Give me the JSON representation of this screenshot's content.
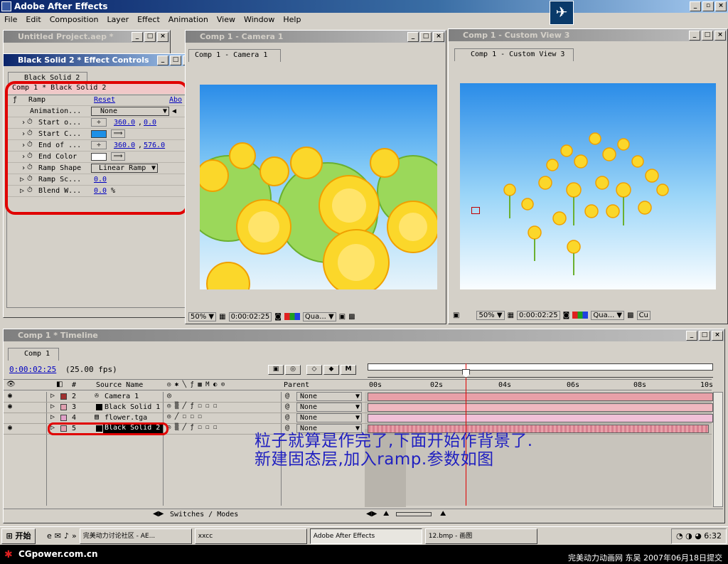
{
  "app": {
    "title": "Adobe After Effects"
  },
  "menu": [
    "File",
    "Edit",
    "Composition",
    "Layer",
    "Effect",
    "Animation",
    "View",
    "Window",
    "Help"
  ],
  "project": {
    "title": "Untitled Project.aep *"
  },
  "effect_controls": {
    "title": "Black Solid 2 * Effect Controls",
    "tab": "Black Solid 2",
    "breadcrumb": "Comp 1 * Black Solid 2",
    "effect_name": "Ramp",
    "reset": "Reset",
    "about": "Abo",
    "props": [
      {
        "label": "Animation...",
        "value": "None"
      },
      {
        "label": "Start o...",
        "v1": "360.0",
        "v2": "0.0"
      },
      {
        "label": "Start C...",
        "color": "#1e90e6"
      },
      {
        "label": "End of ...",
        "v1": "360.0",
        "v2": "576.0"
      },
      {
        "label": "End Color",
        "color": "#ffffff"
      },
      {
        "label": "Ramp Shape",
        "value": "Linear Ramp"
      },
      {
        "label": "Ramp Sc...",
        "value": "0.0"
      },
      {
        "label": "Blend W...",
        "value": "0.0",
        "unit": "%"
      }
    ]
  },
  "comp_camera": {
    "title": "Comp 1 - Camera 1",
    "tab": "Comp 1 - Camera 1",
    "zoom": "50%",
    "time": "0:00:02:25",
    "quality": "Qua..."
  },
  "comp_custom": {
    "title": "Comp 1 - Custom View 3",
    "tab": "Comp 1 - Custom View 3",
    "zoom": "50%",
    "time": "0:00:02:25",
    "quality": "Qua...",
    "view": "Cu"
  },
  "timeline": {
    "title": "Comp 1 * Timeline",
    "tab": "Comp 1",
    "time": "0:00:02:25",
    "fps": "(25.00 fps)",
    "col_num": "#",
    "col_source": "Source Name",
    "col_parent": "Parent",
    "switches_modes": "Switches / Modes",
    "ruler": [
      "00s",
      "02s",
      "04s",
      "06s",
      "08s",
      "10s"
    ],
    "layers": [
      {
        "num": "2",
        "name": "Camera 1",
        "parent": "None",
        "color": "#a03030"
      },
      {
        "num": "3",
        "name": "Black Solid 1",
        "parent": "None",
        "color": "#e0a0b0"
      },
      {
        "num": "4",
        "name": "flower.tga",
        "parent": "None",
        "color": "#e0a0c8"
      },
      {
        "num": "5",
        "name": "Black Solid 2",
        "parent": "None",
        "color": "#e0a0b0"
      }
    ]
  },
  "annotation": {
    "line1": "粒子就算是作完了,下面开始作背景了.",
    "line2": "新建固态层,加入ramp.参数如图"
  },
  "taskbar": {
    "start": "开始",
    "items": [
      "完美动力讨论社区 - AE...",
      "xxcc",
      "Adobe After Effects",
      "12.bmp - 画图"
    ],
    "clock": "6:32"
  },
  "footer": {
    "site": "CGpower.com.cn",
    "credit": "完美动力动画网 东吴 2007年06月18日提交"
  }
}
